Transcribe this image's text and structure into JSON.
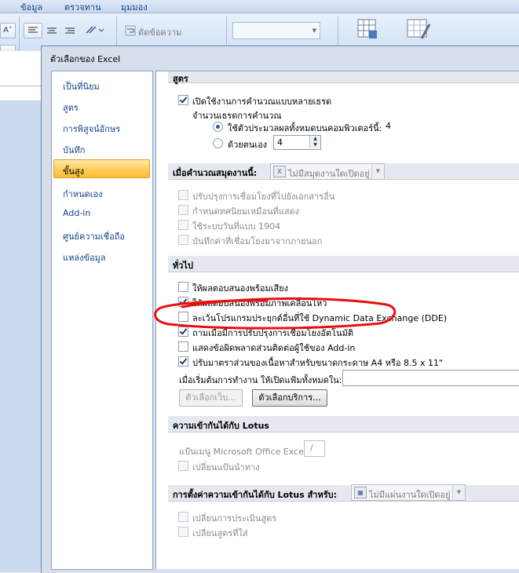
{
  "ribbon": {
    "tabs": [
      "ข้อมูล",
      "ตรวจทาน",
      "มุมมอง"
    ],
    "group_label": "ตัดข้อความ"
  },
  "dialog": {
    "title": "ตัวเลือกของ Excel"
  },
  "nav": {
    "items": [
      {
        "label": "เป็นที่นิยม"
      },
      {
        "label": "สูตร"
      },
      {
        "label": "การพิสูจน์อักษร"
      },
      {
        "label": "บันทึก"
      },
      {
        "label": "ขั้นสูง"
      },
      {
        "label": "กำหนดเอง"
      },
      {
        "label": "Add-in"
      },
      {
        "label": "ศูนย์ความเชื่อถือ"
      },
      {
        "label": "แหล่งข้อมูล"
      }
    ],
    "active": "ขั้นสูง"
  },
  "formulas": {
    "header": "สูตร",
    "multithread_label": "เปิดใช้งานการคำนวณแบบหลายเธรด",
    "thread_count_label": "จำนวนเธรดการคำนวณ",
    "use_all_label": "ใช้ตัวประมวลผลทั้งหมดบนคอมพิวเตอร์นี้:",
    "use_all_value": "4",
    "manual_label": "ด้วยตนเอง",
    "manual_value": "4"
  },
  "workbook": {
    "header": "เมื่อคำนวณสมุดงานนี้:",
    "combo_value": "ไม่มีสมุดงานใดเปิดอยู่",
    "options": [
      "ปรับปรุงการเชื่อมโยงที่ไปยังเอกสารอื่น",
      "กำหนดทศนิยมเหมือนที่แสดง",
      "ใช้ระบบวันที่แบบ 1904",
      "บันทึกค่าที่เชื่อมโยงมาจากภายนอก"
    ]
  },
  "general": {
    "header": "ทั่วไป",
    "options": [
      {
        "label": "ให้ผลตอบสนองพร้อมเสียง",
        "checked": false
      },
      {
        "label": "ให้ผลตอบสนองพร้อมภาพเคลื่อนไหว",
        "checked": true
      },
      {
        "label": "ละเว้นโปรแกรมประยุกต์อื่นที่ใช้ Dynamic Data Exchange (DDE)",
        "checked": false
      },
      {
        "label": "ถามเมื่อมีการปรับปรุงการเชื่อมโยงอัตโนมัติ",
        "checked": true
      },
      {
        "label": "แสดงข้อผิดพลาดส่วนติดต่อผู้ใช้ของ Add-in",
        "checked": false
      },
      {
        "label": "ปรับมาตราส่วนของเนื้อหาสำหรับขนาดกระดาษ A4 หรือ 8.5 x 11\"",
        "checked": true
      }
    ],
    "startup_label": "เมื่อเริ่มต้นการทำงาน ให้เปิดแฟ้มทั้งหมดใน:",
    "startup_value": "",
    "web_options_button": "ตัวเลือกเว็บ...",
    "service_options_button": "ตัวเลือกบริการ..."
  },
  "lotus": {
    "header": "ความเข้ากันได้กับ Lotus",
    "menu_key_label": "แป้นเมนู Microsoft Office Excel:",
    "menu_key_value": "/",
    "transition_nav_label": "เปลี่ยนแป้นนำทาง"
  },
  "lotus_settings": {
    "header": "การตั้งค่าความเข้ากันได้กับ Lotus สำหรับ:",
    "combo_value": "ไม่มีแผ่นงานใดเปิดอยู่",
    "options": [
      "เปลี่ยนการประเมินสูตร",
      "เปลี่ยนสูตรที่ใส่"
    ]
  },
  "annotation": {
    "color": "#e8100f",
    "shape": "hand-drawn-ellipse"
  }
}
